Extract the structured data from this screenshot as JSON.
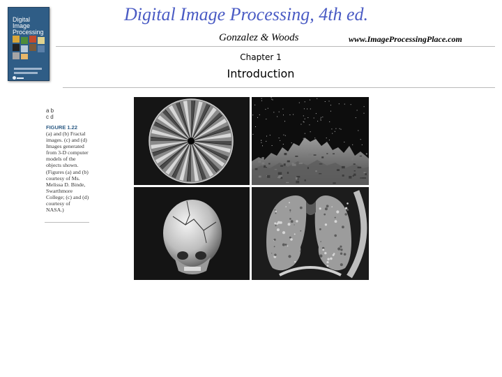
{
  "header": {
    "title": "Digital Image Processing, 4th ed.",
    "authors": "Gonzalez & Woods",
    "website": "www.ImageProcessingPlace.com"
  },
  "book_cover": {
    "title_line1": "Digital Image",
    "title_line2": "Processing"
  },
  "chapter": {
    "label": "Chapter 1",
    "title": "Introduction"
  },
  "figure": {
    "grid_labels": [
      "a b",
      "c d"
    ],
    "label": "FIGURE 1.22",
    "caption": "(a) and (b) Fractal images. (c) and (d) Images generated from 3-D computer models of the objects shown. (Figures (a) and (b) courtesy of Ms. Melissa D. Binde, Swarthmore College; (c) and (d) courtesy of NASA.)"
  },
  "colors": {
    "title": "#4a5bc4",
    "cover": "#2f5d86",
    "rule": "#b9b9b9"
  },
  "images": [
    {
      "id": "a",
      "depicts": "fractal-radial-pattern"
    },
    {
      "id": "b",
      "depicts": "fractal-mountain-landscape"
    },
    {
      "id": "c",
      "depicts": "3d-skull-model"
    },
    {
      "id": "d",
      "depicts": "3d-lung-model"
    }
  ]
}
